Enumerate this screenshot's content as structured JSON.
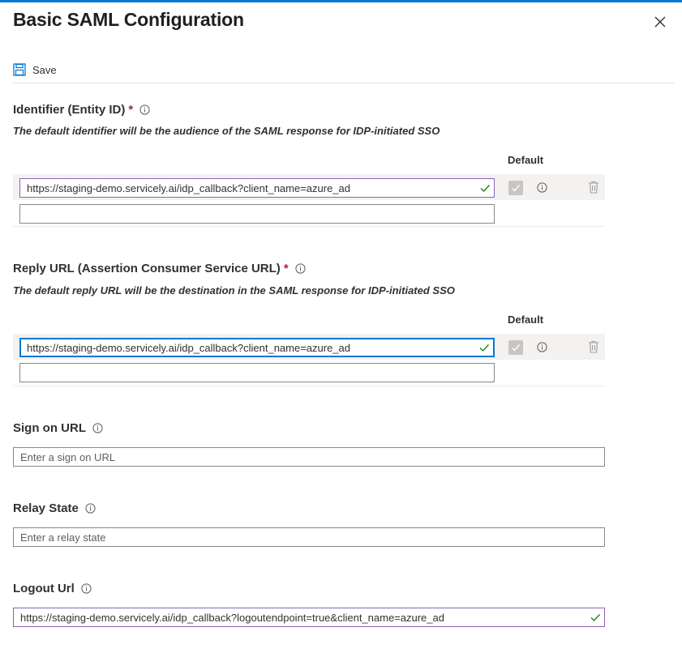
{
  "panel": {
    "title": "Basic SAML Configuration",
    "save_label": "Save"
  },
  "identifier": {
    "label": "Identifier (Entity ID)",
    "required_mark": "*",
    "description": "The default identifier will be the audience of the SAML response for IDP-initiated SSO",
    "default_header": "Default",
    "value": "https://staging-demo.servicely.ai/idp_callback?client_name=azure_ad",
    "empty_value": ""
  },
  "reply_url": {
    "label": "Reply URL (Assertion Consumer Service URL)",
    "required_mark": "*",
    "description": "The default reply URL will be the destination in the SAML response for IDP-initiated SSO",
    "default_header": "Default",
    "value": "https://staging-demo.servicely.ai/idp_callback?client_name=azure_ad",
    "empty_value": ""
  },
  "sign_on_url": {
    "label": "Sign on URL",
    "placeholder": "Enter a sign on URL"
  },
  "relay_state": {
    "label": "Relay State",
    "placeholder": "Enter a relay state"
  },
  "logout_url": {
    "label": "Logout Url",
    "value": "https://staging-demo.servicely.ai/idp_callback?logoutendpoint=true&client_name=azure_ad"
  },
  "colors": {
    "accent": "#0078d4",
    "valid_check": "#107c10",
    "valid_border": "#8764b8",
    "required": "#a4262c"
  },
  "icons": [
    "close-icon",
    "save-icon",
    "info-icon",
    "checkmark-icon",
    "trash-icon"
  ]
}
